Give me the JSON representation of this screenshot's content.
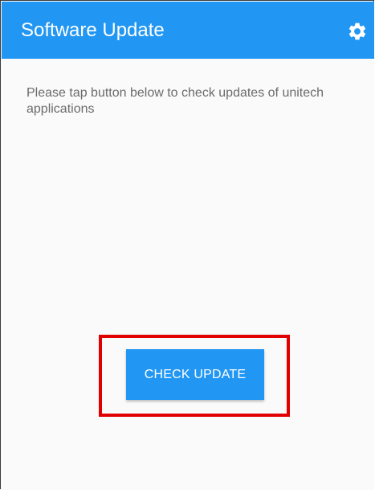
{
  "app_bar": {
    "title": "Software Update",
    "settings_icon": "gear-icon",
    "background_color": "#2196f3"
  },
  "main": {
    "message": "Please tap button below to check updates of unitech applications",
    "check_button_label": "CHECK UPDATE",
    "button_color": "#2196f3",
    "highlight_color": "#e10000"
  }
}
